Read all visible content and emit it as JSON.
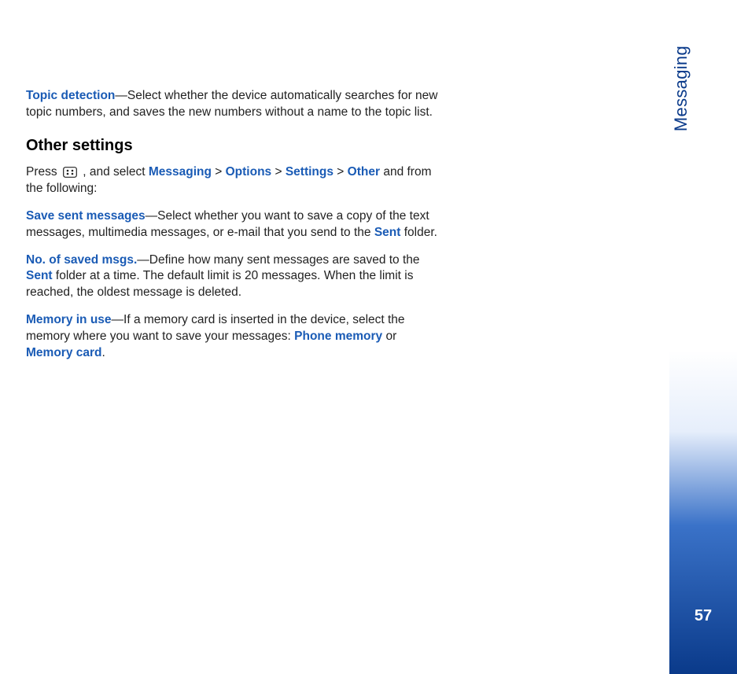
{
  "sidebar": {
    "section_label": "Messaging",
    "page_number": "57"
  },
  "content": {
    "topic_detection": {
      "label": "Topic detection",
      "sep": "—",
      "text": "Select whether the device automatically searches for new topic numbers, and saves the new numbers without a name to the topic list."
    },
    "heading_other_settings": "Other settings",
    "intro": {
      "pre": "Press ",
      "post1": " , and select ",
      "nav_messaging": "Messaging",
      "sep1": " > ",
      "nav_options": "Options",
      "sep2": " > ",
      "nav_settings": "Settings",
      "sep3": " > ",
      "nav_other": "Other",
      "tail": " and from the following:"
    },
    "save_sent": {
      "label": "Save sent messages",
      "sep": "—",
      "text_pre": "Select whether you want to save a copy of the text messages, multimedia messages, or e-mail that you send to the ",
      "sent_label": "Sent",
      "text_post": " folder."
    },
    "no_saved": {
      "label": "No. of saved msgs.",
      "sep": "—",
      "text_pre": "Define how many sent messages are saved to the ",
      "sent_label": "Sent",
      "text_post": " folder at a time. The default limit is 20 messages. When the limit is reached, the oldest message is deleted."
    },
    "memory_in_use": {
      "label": "Memory in use",
      "sep": "—",
      "text_pre": "If a memory card is inserted in the device, select the memory where you want to save your messages: ",
      "phone_memory": "Phone memory",
      "or": " or ",
      "memory_card": "Memory card",
      "period": "."
    }
  }
}
